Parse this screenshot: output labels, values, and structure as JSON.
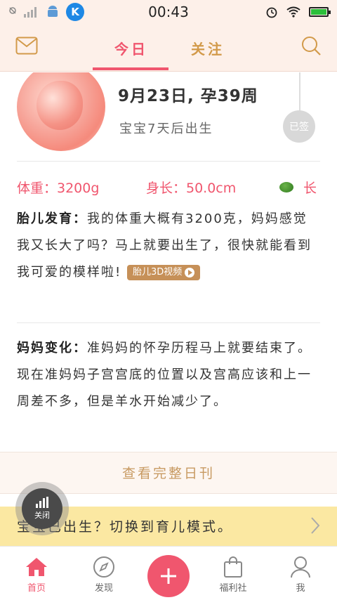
{
  "status_bar": {
    "time": "00:43",
    "badge_letter": "K",
    "battery_level": 1.0
  },
  "header": {
    "tabs": [
      {
        "label": "今日",
        "active": true
      },
      {
        "label": "关注",
        "active": false
      }
    ]
  },
  "today": {
    "date_title": "9月23日, 孕39周",
    "days_to_birth": "宝宝7天后出生",
    "signed_label": "已签",
    "weight": "体重：3200g",
    "length": "身长：50.0cm",
    "grow_label": "长"
  },
  "fetal_development": {
    "heading": "胎儿发育：",
    "text": "我的体重大概有3200克，妈妈感觉我又长大了吗？马上就要出生了，很快就能看到我可爱的模样啦!",
    "video_label": "胎儿3D视频"
  },
  "mom_changes": {
    "heading": "妈妈变化：",
    "text": "准妈妈的怀孕历程马上就要结束了。现在准妈妈子宫宫底的位置以及宫高应该和上一周差不多，但是羊水开始减少了。"
  },
  "view_full_label": "查看完整日刊",
  "banner_text": "宝宝已出生？切换到育儿模式。",
  "float_button_label": "关闭",
  "bottom_nav": {
    "home": "首页",
    "discover": "发现",
    "welfare": "福利社",
    "me": "我"
  },
  "colors": {
    "accent": "#f0566e",
    "gold": "#c89a62",
    "header_bg": "#fdf0e9",
    "banner_bg": "#fbe8a2"
  }
}
